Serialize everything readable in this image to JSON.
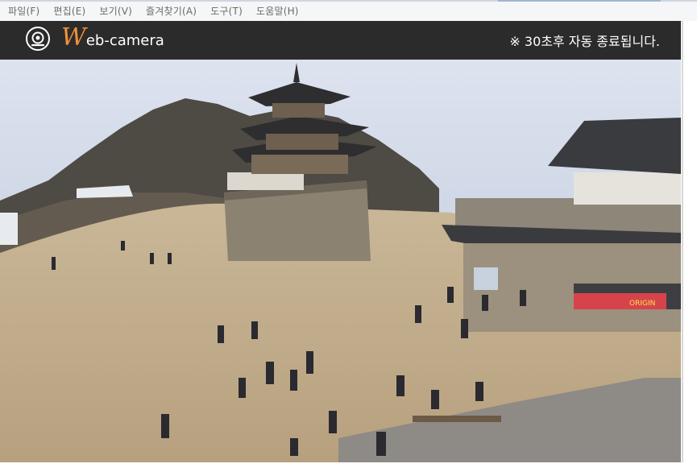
{
  "menu": {
    "items": [
      "파일(F)",
      "편집(E)",
      "보기(V)",
      "즐겨찾기(A)",
      "도구(T)",
      "도움말(H)"
    ]
  },
  "header": {
    "logo_initial": "W",
    "logo_rest": "eb-camera",
    "notice": "※ 30초후 자동 종료됩니다.",
    "background": "#2b2b2b",
    "logo_accent": "#f0923a"
  },
  "camera": {
    "kind": "live webcam still",
    "sign_text": "ORIGIN"
  }
}
